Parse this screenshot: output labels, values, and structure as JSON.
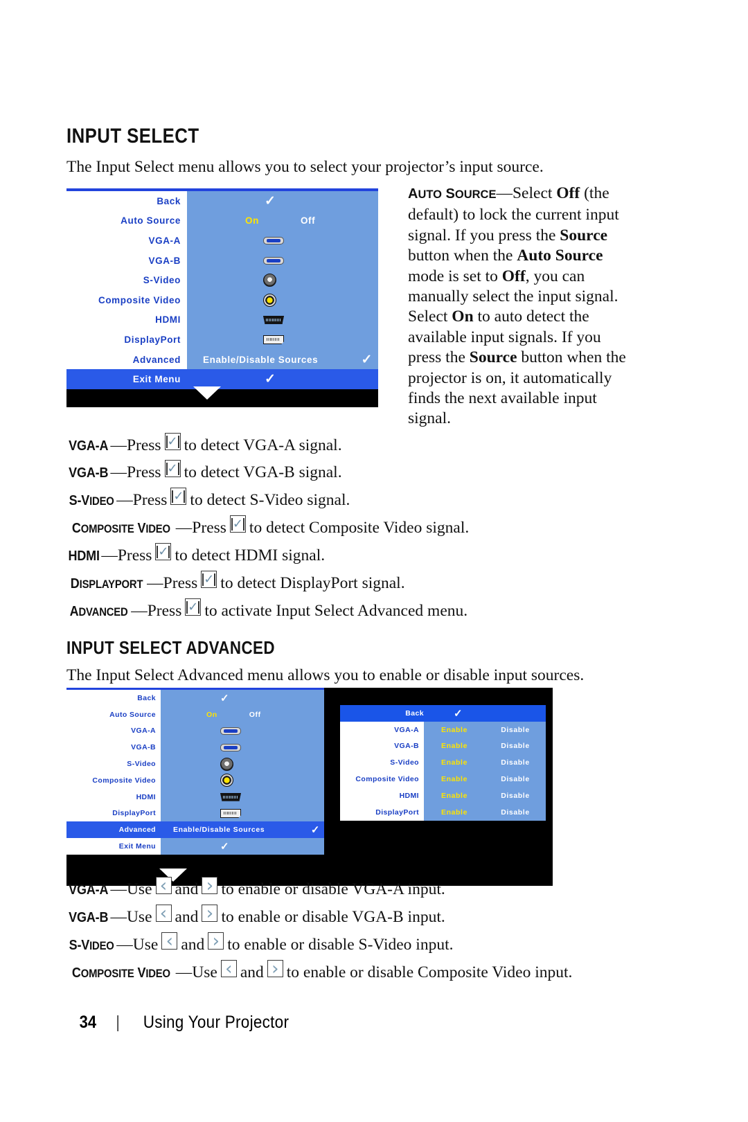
{
  "page": {
    "number": "34",
    "separator": "|",
    "footer_text": "Using Your Projector"
  },
  "section1": {
    "heading": "INPUT SELECT",
    "intro": "The Input Select menu allows you to select your projector’s input source."
  },
  "osd_input_select": {
    "rows": [
      {
        "label": "Back",
        "value_type": "check",
        "value": "✓"
      },
      {
        "label": "Auto Source",
        "value_type": "onoff",
        "on": "On",
        "off": "Off"
      },
      {
        "label": "VGA-A",
        "value_type": "icon",
        "icon": "vga-connector-icon"
      },
      {
        "label": "VGA-B",
        "value_type": "icon",
        "icon": "vga-connector-icon"
      },
      {
        "label": "S-Video",
        "value_type": "icon",
        "icon": "s-video-connector-icon"
      },
      {
        "label": "Composite Video",
        "value_type": "icon",
        "icon": "composite-video-connector-icon"
      },
      {
        "label": "HDMI",
        "value_type": "icon",
        "icon": "hdmi-connector-icon"
      },
      {
        "label": "DisplayPort",
        "value_type": "icon",
        "icon": "displayport-connector-icon"
      },
      {
        "label": "Advanced",
        "value_type": "text",
        "value": "Enable/Disable Sources",
        "check": "✓"
      },
      {
        "label": "Exit Menu",
        "value_type": "check",
        "value": "✓",
        "highlighted": true
      }
    ],
    "colors": {
      "label_bg": "#ffffff",
      "label_text": "#1a3fc4",
      "value_bg": "#6f9ede",
      "highlight_bg": "#2a5ae8",
      "selected_text": "#ffe400",
      "frame": "#000000",
      "topline": "#2244dd"
    }
  },
  "auto_source_desc": {
    "term": "AUTO SOURCE",
    "text_1": "—Select ",
    "b_off_1": "Off",
    "text_2": " (the default) to lock the current input signal. If you press the ",
    "b_source_1": "Source",
    "text_3": " button when the ",
    "b_auto_source": "Auto Source",
    "text_4": " mode is set to ",
    "b_off_2": "Off",
    "text_5": ", you can manually select the input signal. Select ",
    "b_on": "On",
    "text_6": " to auto detect the available input signals. If you press the ",
    "b_source_2": "Source",
    "text_7": " button when the projector is on, it automatically finds the next available input signal."
  },
  "input_lines": [
    {
      "term": "VGA-A",
      "term_caps": "VGA-A",
      "pre": "—Press ",
      "icon": "enter-button-icon",
      "post": " to detect VGA-A signal."
    },
    {
      "term": "VGA-B",
      "term_caps": "VGA-B",
      "pre": "—Press ",
      "icon": "enter-button-icon",
      "post": " to detect VGA-B signal."
    },
    {
      "term": "S-VIDEO",
      "term_caps": "S-Video",
      "pre": "—Press ",
      "icon": "enter-button-icon",
      "post": " to detect S-Video signal."
    },
    {
      "term": "COMPOSITE VIDEO",
      "term_caps": "Composite Video",
      "pre": "—Press ",
      "icon": "enter-button-icon",
      "post": " to detect Composite Video signal."
    },
    {
      "term": "HDMI",
      "term_caps": "HDMI",
      "pre": "—Press ",
      "icon": "enter-button-icon",
      "post": " to detect HDMI signal."
    },
    {
      "term": "DISPLAYPORT",
      "term_caps": "DisplayPort",
      "pre": "—Press ",
      "icon": "enter-button-icon",
      "post": " to detect DisplayPort signal."
    },
    {
      "term": "ADVANCED",
      "term_caps": "Advanced",
      "pre": "—Press ",
      "icon": "enter-button-icon",
      "post": " to activate Input Select Advanced menu."
    }
  ],
  "section2": {
    "heading": "INPUT SELECT ADVANCED",
    "intro": "The Input Select Advanced menu allows you to enable or disable input sources."
  },
  "osd_advanced_left": {
    "rows": [
      {
        "label": "Back",
        "value_type": "check",
        "value": "✓"
      },
      {
        "label": "Auto Source",
        "value_type": "onoff",
        "on": "On",
        "off": "Off"
      },
      {
        "label": "VGA-A",
        "value_type": "icon",
        "icon": "vga-connector-icon"
      },
      {
        "label": "VGA-B",
        "value_type": "icon",
        "icon": "vga-connector-icon"
      },
      {
        "label": "S-Video",
        "value_type": "icon",
        "icon": "s-video-connector-icon"
      },
      {
        "label": "Composite Video",
        "value_type": "icon",
        "icon": "composite-video-connector-icon"
      },
      {
        "label": "HDMI",
        "value_type": "icon",
        "icon": "hdmi-connector-icon"
      },
      {
        "label": "DisplayPort",
        "value_type": "icon",
        "icon": "displayport-connector-icon"
      },
      {
        "label": "Advanced",
        "value_type": "text",
        "value": "Enable/Disable Sources",
        "check": "✓",
        "highlighted": true
      },
      {
        "label": "Exit Menu",
        "value_type": "check",
        "value": "✓"
      }
    ]
  },
  "osd_advanced_right": {
    "header": {
      "label": "Back",
      "check": "✓",
      "highlighted": true
    },
    "col_enable": "Enable",
    "col_disable": "Disable",
    "rows": [
      {
        "label": "VGA-A",
        "enable": "Enable",
        "disable": "Disable",
        "selected": "Enable"
      },
      {
        "label": "VGA-B",
        "enable": "Enable",
        "disable": "Disable",
        "selected": "Enable"
      },
      {
        "label": "S-Video",
        "enable": "Enable",
        "disable": "Disable",
        "selected": "Enable"
      },
      {
        "label": "Composite Video",
        "enable": "Enable",
        "disable": "Disable",
        "selected": "Enable"
      },
      {
        "label": "HDMI",
        "enable": "Enable",
        "disable": "Disable",
        "selected": "Enable"
      },
      {
        "label": "DisplayPort",
        "enable": "Enable",
        "disable": "Disable",
        "selected": "Enable"
      }
    ]
  },
  "enable_lines": [
    {
      "term": "VGA-A",
      "term_caps": "VGA-A",
      "pre": "—Use ",
      "and": " and ",
      "post": " to enable or disable VGA-A input."
    },
    {
      "term": "VGA-B",
      "term_caps": "VGA-B",
      "pre": "—Use ",
      "and": " and ",
      "post": " to enable or disable VGA-B input."
    },
    {
      "term": "S-VIDEO",
      "term_caps": "S-Video",
      "pre": "—Use ",
      "and": " and ",
      "post": " to enable or disable S-Video input."
    },
    {
      "term": "COMPOSITE VIDEO",
      "term_caps": "Composite Video",
      "pre": "—Use ",
      "and": " and ",
      "post": " to enable or disable Composite Video input."
    }
  ],
  "glyphs": {
    "check": "✓",
    "left_arrow": "‹",
    "right_arrow": "›",
    "down_triangle": "▼"
  }
}
